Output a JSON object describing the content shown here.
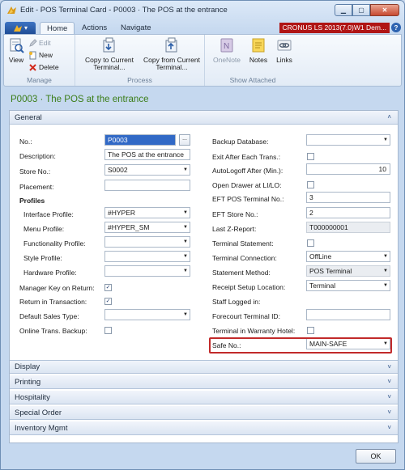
{
  "window": {
    "title": "Edit - POS Terminal Card - P0003 · The POS at the entrance",
    "controls": {
      "minimize": "▁",
      "maximize": "▢",
      "close": "✕"
    }
  },
  "ribbon_tabs": {
    "app_menu": "▾",
    "home": "Home",
    "actions": "Actions",
    "navigate": "Navigate"
  },
  "company": "CRONUS LS 2013(7.0)W1 Dem...",
  "help": "?",
  "ribbon": {
    "manage": {
      "label": "Manage",
      "view": "View",
      "edit": "Edit",
      "new": "New",
      "delete": "Delete"
    },
    "process": {
      "label": "Process",
      "copy_to": "Copy to Current Terminal...",
      "copy_from": "Copy from Current Terminal..."
    },
    "show_attached": {
      "label": "Show Attached",
      "onenote": "OneNote",
      "notes": "Notes",
      "links": "Links"
    }
  },
  "card_title": "P0003 · The POS at the entrance",
  "general": {
    "header": "General",
    "left": {
      "no_label": "No.:",
      "no_value": "P0003",
      "no_assist": "...",
      "description_label": "Description:",
      "description_value": "The POS at the entrance",
      "store_no_label": "Store No.:",
      "store_no_value": "S0002",
      "placement_label": "Placement:",
      "placement_value": "",
      "profiles_heading": "Profiles",
      "interface_profile_label": "Interface Profile:",
      "interface_profile_value": "#HYPER",
      "menu_profile_label": "Menu Profile:",
      "menu_profile_value": "#HYPER_SM",
      "functionality_profile_label": "Functionality Profile:",
      "functionality_profile_value": "",
      "style_profile_label": "Style Profile:",
      "style_profile_value": "",
      "hardware_profile_label": "Hardware Profile:",
      "hardware_profile_value": "",
      "manager_key_label": "Manager Key on Return:",
      "manager_key_checked": true,
      "return_in_trans_label": "Return in Transaction:",
      "return_in_trans_checked": true,
      "default_sales_type_label": "Default Sales Type:",
      "default_sales_type_value": "",
      "online_trans_backup_label": "Online Trans. Backup:",
      "online_trans_backup_checked": false
    },
    "right": {
      "backup_database_label": "Backup Database:",
      "backup_database_value": "",
      "exit_after_each_label": "Exit After Each Trans.:",
      "exit_after_each_checked": false,
      "autologoff_label": "AutoLogoff After (Min.):",
      "autologoff_value": "10",
      "open_drawer_label": "Open Drawer at LI/LO:",
      "open_drawer_checked": false,
      "eft_pos_terminal_label": "EFT POS Terminal No.:",
      "eft_pos_terminal_value": "3",
      "eft_store_label": "EFT Store No.:",
      "eft_store_value": "2",
      "last_z_report_label": "Last Z-Report:",
      "last_z_report_value": "T000000001",
      "terminal_statement_label": "Terminal Statement:",
      "terminal_statement_checked": false,
      "terminal_connection_label": "Terminal Connection:",
      "terminal_connection_value": "OffLine",
      "statement_method_label": "Statement Method:",
      "statement_method_value": "POS Terminal",
      "receipt_setup_label": "Receipt Setup Location:",
      "receipt_setup_value": "Terminal",
      "staff_logged_in_label": "Staff Logged in:",
      "forecourt_terminal_label": "Forecourt Terminal ID:",
      "forecourt_terminal_value": "",
      "warranty_hotel_label": "Terminal in Warranty Hotel:",
      "warranty_hotel_checked": false,
      "safe_no_label": "Safe No.:",
      "safe_no_value": "MAIN-SAFE"
    }
  },
  "fasttabs": [
    "Display",
    "Printing",
    "Hospitality",
    "Special Order",
    "Inventory Mgmt"
  ],
  "ok_button": "OK",
  "icons": {
    "collapse": "˄",
    "expand": "˅",
    "dropdown": "▼",
    "check": "✓"
  }
}
